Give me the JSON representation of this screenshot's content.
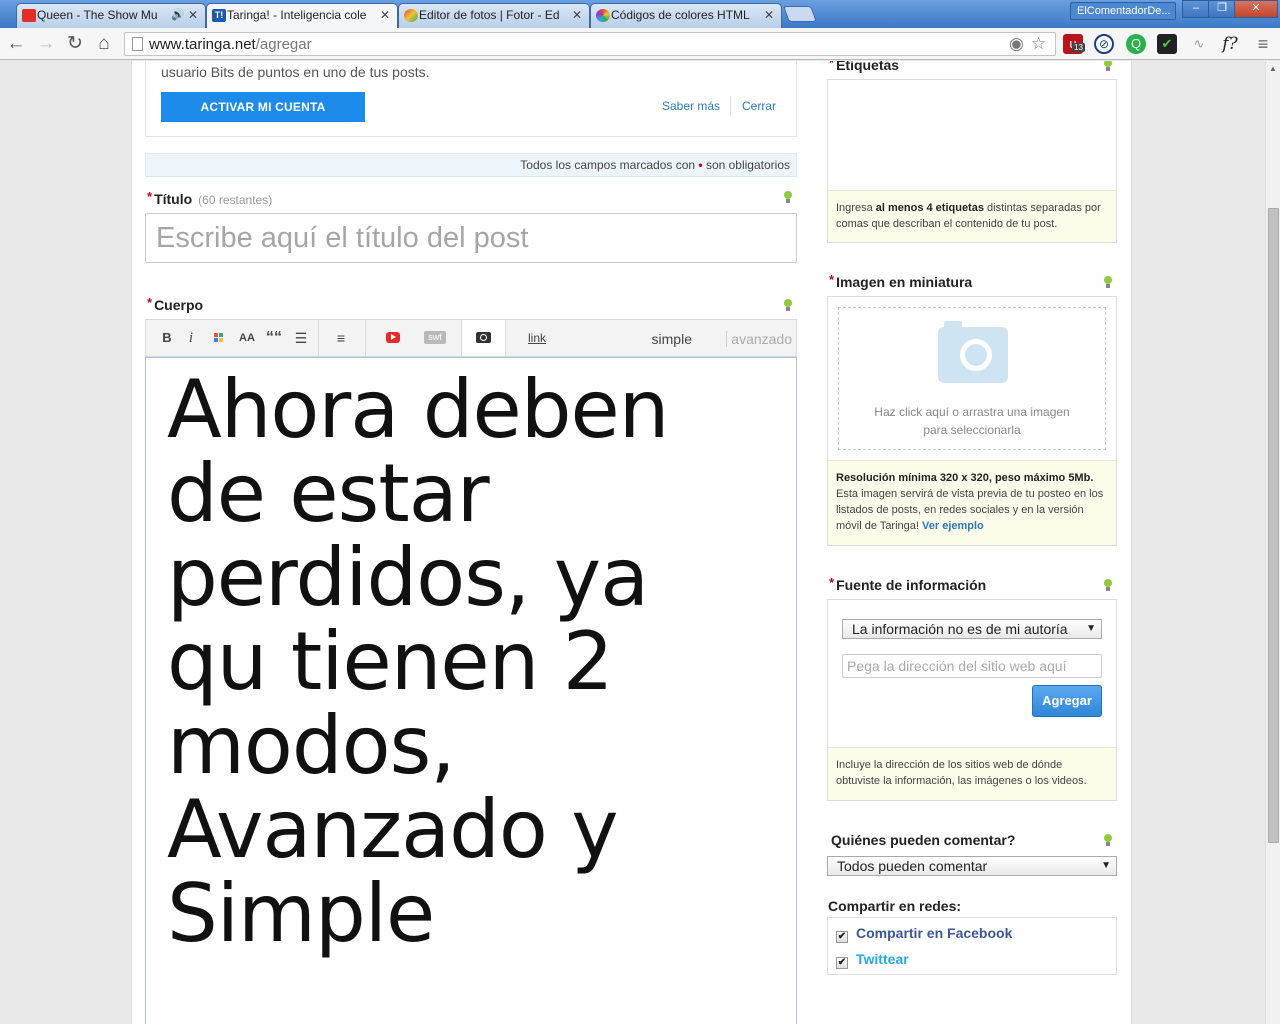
{
  "browser": {
    "tabs": [
      {
        "title": "Queen - The Show Mu",
        "favicon_color": "#e52d27"
      },
      {
        "title": "Taringa! - Inteligencia cole",
        "favicon_color": "#1a5aa8"
      },
      {
        "title": "Editor de fotos | Fotor - Ed",
        "favicon_color": "#e39b2e"
      },
      {
        "title": "Códigos de colores HTML",
        "favicon_color": "#2aa8d8"
      }
    ],
    "profile_name": "ElComentadorDe...",
    "url_host": "www.taringa.net",
    "url_path": "/agregar",
    "ext_badge": "13"
  },
  "notice": {
    "text": "usuario Bits de puntos en uno de tus posts.",
    "activate_label": "ACTIVAR MI CUENTA",
    "saber_mas": "Saber más",
    "cerrar": "Cerrar"
  },
  "required_bar": {
    "before": "Todos los campos marcados con",
    "dot": "•",
    "after": "son obligatorios"
  },
  "title_field": {
    "label": "Título",
    "hint": "(60 restantes)",
    "placeholder": "Escribe aquí el título del post"
  },
  "body_field": {
    "label": "Cuerpo",
    "toolbar": {
      "bold": "B",
      "italic": "i",
      "size": "AA",
      "quote": "““",
      "link": "link",
      "swf": "swf",
      "mode_simple": "simple",
      "mode_avanzado": "avanzado"
    },
    "content": "Ahora deben de estar perdidos, ya qu tienen 2 modos, Avanzado y Simple"
  },
  "tags_field": {
    "label": "Etiquetas",
    "info_pre": "Ingresa ",
    "info_bold": "al menos 4 etiquetas",
    "info_post": " distintas separadas por comas que describan el contenido de tu post."
  },
  "thumbnail_field": {
    "label": "Imagen en miniatura",
    "drop_line1": "Haz click aquí o arrastra una imagen",
    "drop_line2": "para seleccionarla",
    "info_bold": "Resolución mínima 320 x 320, peso máximo 5Mb.",
    "info_text": "Esta imagen servirá de vista previa de tu posteo en los listados de posts, en redes sociales y en la versión móvil de Taringa!",
    "info_link": "Ver ejemplo"
  },
  "source_field": {
    "label": "Fuente de información",
    "selected": "La información no es de mi autoría",
    "url_placeholder": "Pega la dirección del sitio web aquí",
    "add_button": "Agregar",
    "info": "Incluye la dirección de los sitios web de dónde obtuviste la información, las imágenes o los videos."
  },
  "comments_field": {
    "label": "Quiénes pueden comentar?",
    "selected": "Todos pueden comentar"
  },
  "share": {
    "label": "Compartir en redes:",
    "facebook": "Compartir en Facebook",
    "twitter": "Twittear",
    "facebook_color": "#3b5998",
    "twitter_color": "#2aa9e0"
  }
}
